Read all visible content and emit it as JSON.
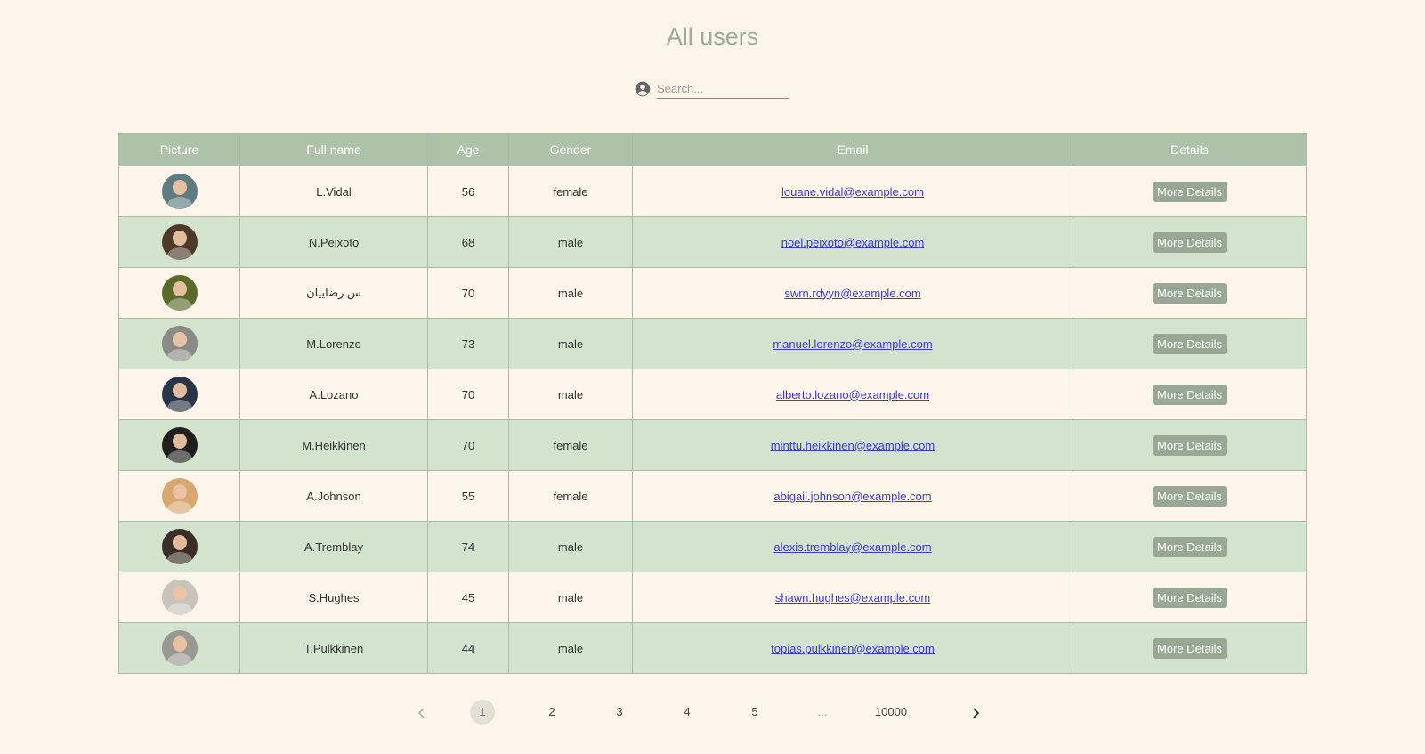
{
  "page": {
    "title": "All users"
  },
  "search": {
    "placeholder": "Search...",
    "value": "",
    "icon": "account-circle-icon"
  },
  "table": {
    "headers": [
      "Picture",
      "Full name",
      "Age",
      "Gender",
      "Email",
      "Details"
    ],
    "button_label": "More Details",
    "rows": [
      {
        "name": "L.Vidal",
        "age": "56",
        "gender": "female",
        "email": "louane.vidal@example.com",
        "avatar_color": "#5f7c82"
      },
      {
        "name": "N.Peixoto",
        "age": "68",
        "gender": "male",
        "email": "noel.peixoto@example.com",
        "avatar_color": "#4e3a28"
      },
      {
        "name": "س.رضاییان",
        "age": "70",
        "gender": "male",
        "email": "swrn.rdyyn@example.com",
        "avatar_color": "#5a6a2a"
      },
      {
        "name": "M.Lorenzo",
        "age": "73",
        "gender": "male",
        "email": "manuel.lorenzo@example.com",
        "avatar_color": "#8a8a86"
      },
      {
        "name": "A.Lozano",
        "age": "70",
        "gender": "male",
        "email": "alberto.lozano@example.com",
        "avatar_color": "#2a3548"
      },
      {
        "name": "M.Heikkinen",
        "age": "70",
        "gender": "female",
        "email": "minttu.heikkinen@example.com",
        "avatar_color": "#22201e"
      },
      {
        "name": "A.Johnson",
        "age": "55",
        "gender": "female",
        "email": "abigail.johnson@example.com",
        "avatar_color": "#d8a870"
      },
      {
        "name": "A.Tremblay",
        "age": "74",
        "gender": "male",
        "email": "alexis.tremblay@example.com",
        "avatar_color": "#3a2e26"
      },
      {
        "name": "S.Hughes",
        "age": "45",
        "gender": "male",
        "email": "shawn.hughes@example.com",
        "avatar_color": "#c8c4bc"
      },
      {
        "name": "T.Pulkkinen",
        "age": "44",
        "gender": "male",
        "email": "topias.pulkkinen@example.com",
        "avatar_color": "#9a9892"
      }
    ]
  },
  "pagination": {
    "prev_icon": "chevron-left-icon",
    "next_icon": "chevron-right-icon",
    "pages": [
      "1",
      "2",
      "3",
      "4",
      "5",
      "...",
      "10000"
    ],
    "current": "1"
  },
  "colors": {
    "background": "#fdf4ea",
    "header": "#adc2a9",
    "row_alt": "#d2e4cd",
    "button": "#98a894",
    "title": "#9aae96",
    "link": "#3b3bd0"
  }
}
